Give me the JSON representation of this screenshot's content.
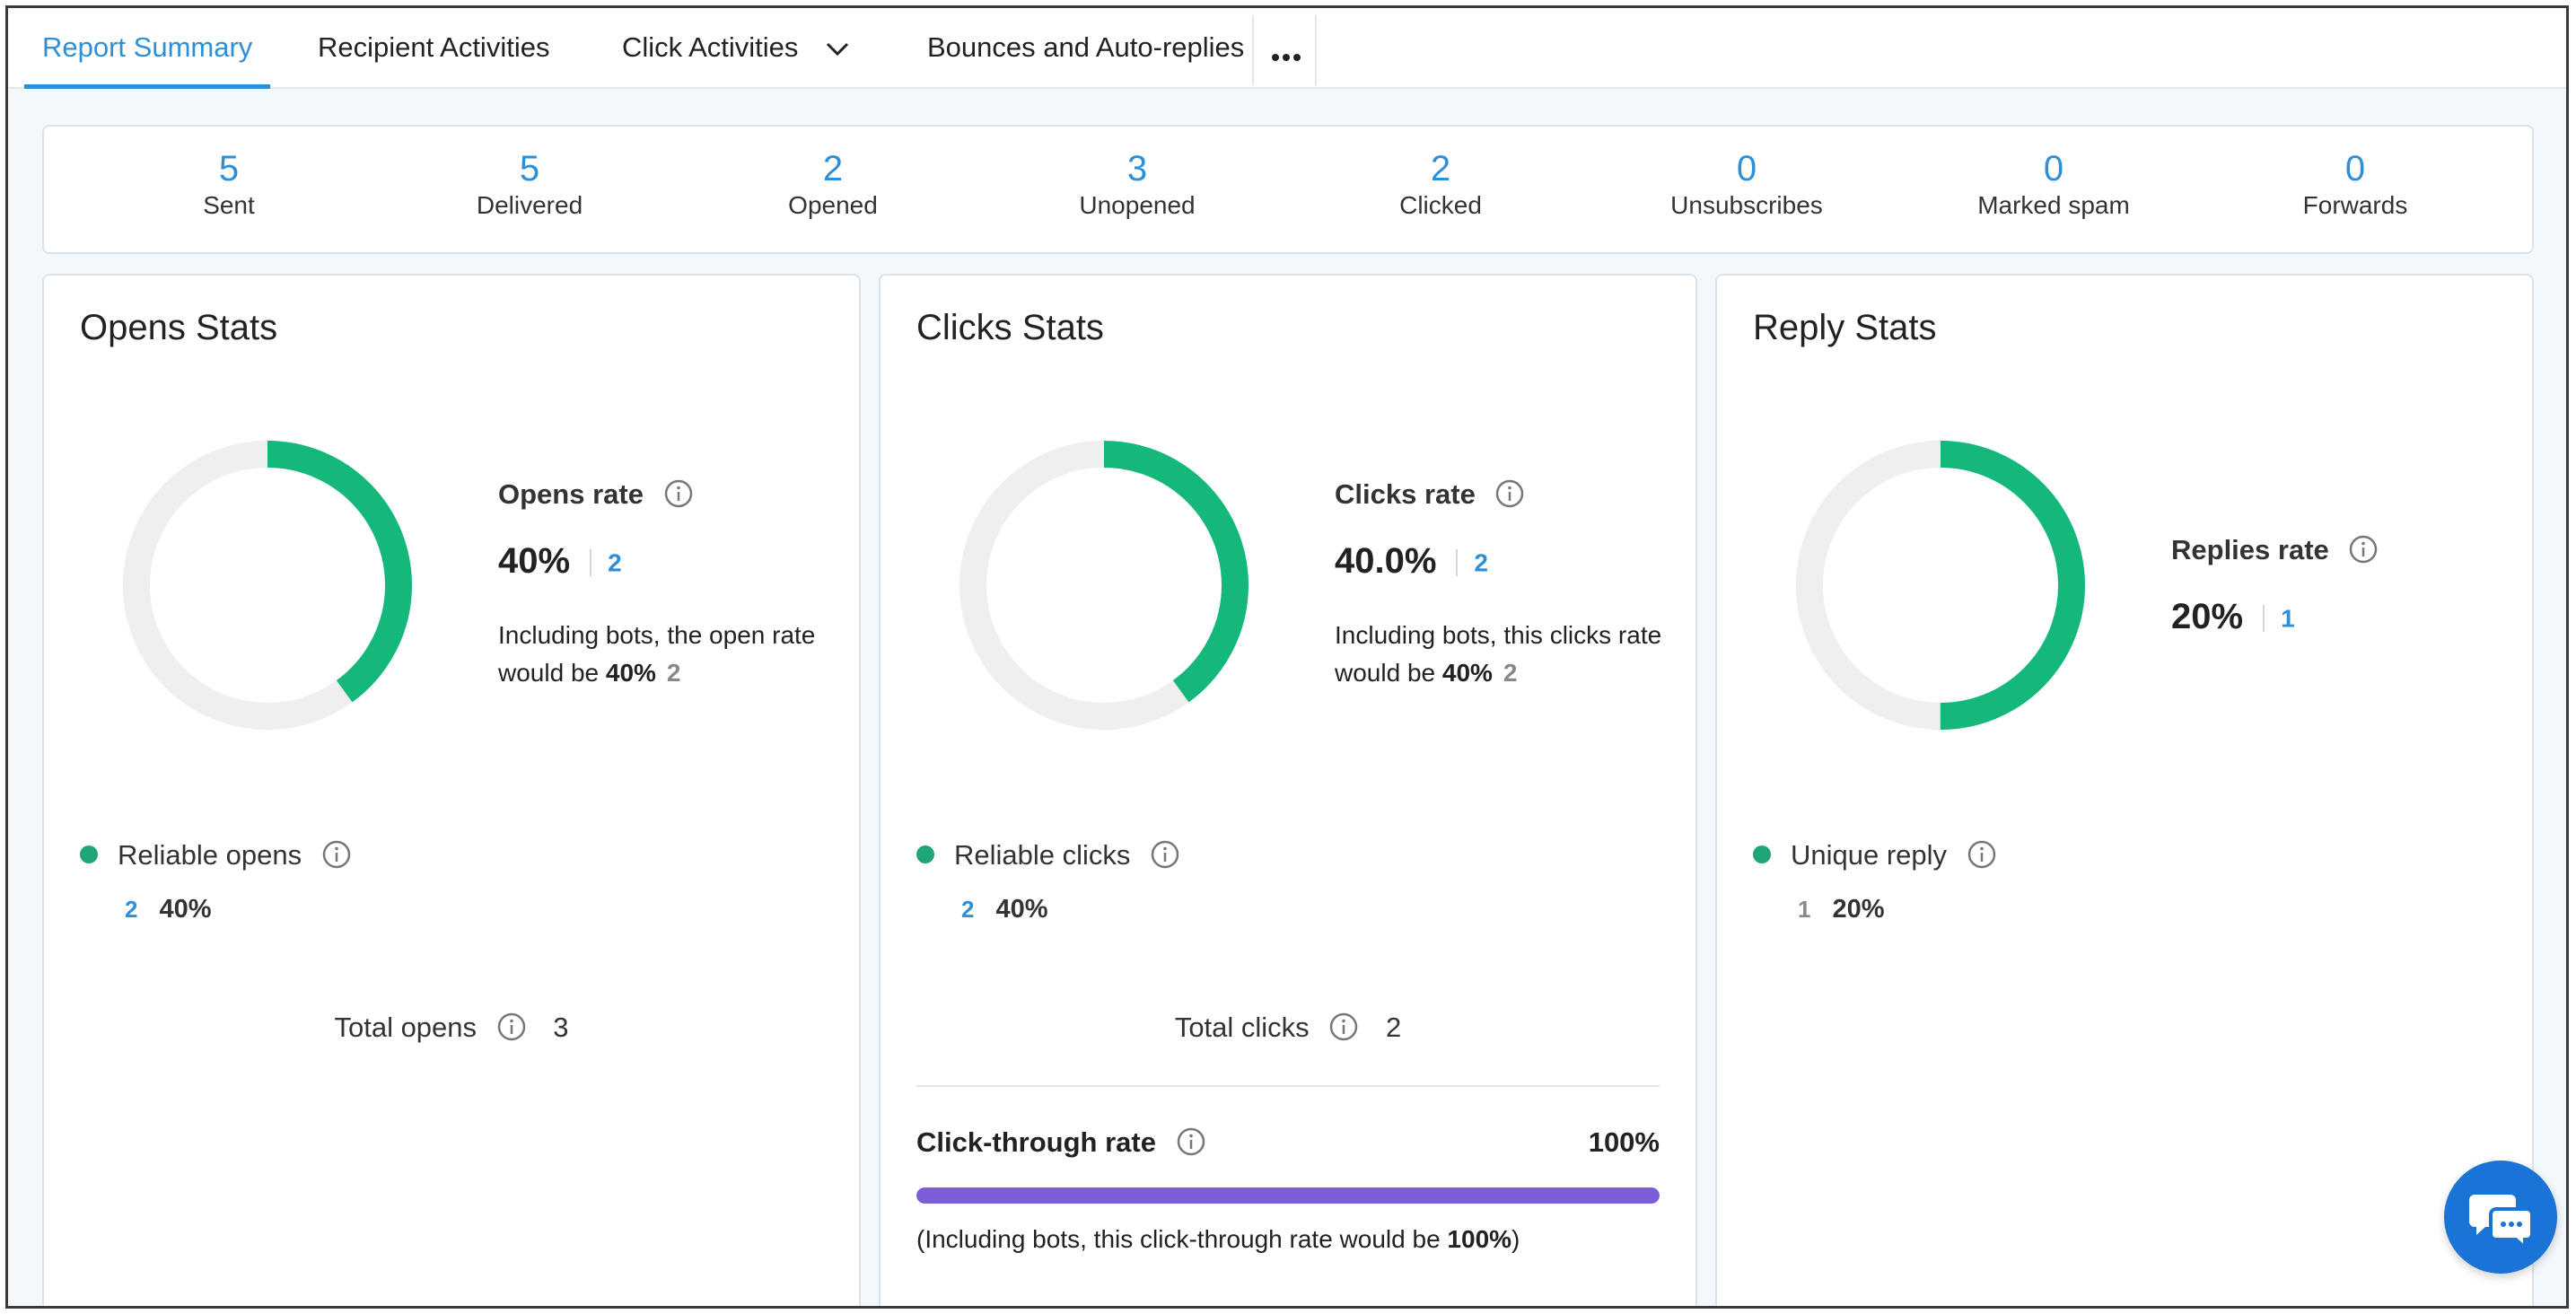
{
  "tabs": {
    "report_summary": "Report Summary",
    "recipient_activities": "Recipient Activities",
    "click_activities": "Click Activities",
    "bounces": "Bounces and Auto-replies",
    "more_icon": "ellipsis-icon"
  },
  "summary": [
    {
      "value": "5",
      "label": "Sent"
    },
    {
      "value": "5",
      "label": "Delivered"
    },
    {
      "value": "2",
      "label": "Opened"
    },
    {
      "value": "3",
      "label": "Unopened"
    },
    {
      "value": "2",
      "label": "Clicked"
    },
    {
      "value": "0",
      "label": "Unsubscribes"
    },
    {
      "value": "0",
      "label": "Marked spam"
    },
    {
      "value": "0",
      "label": "Forwards"
    }
  ],
  "opens": {
    "title": "Opens Stats",
    "rate_title": "Opens rate",
    "rate_value": "40%",
    "rate_count": "2",
    "rate_fraction": 0.4,
    "bots_text": "Including bots, the open rate would be",
    "bots_rate": "40%",
    "bots_count": "2",
    "legend_label": "Reliable opens",
    "legend_count": "2",
    "legend_percent": "40%",
    "total_label": "Total opens",
    "total_value": "3"
  },
  "clicks": {
    "title": "Clicks Stats",
    "rate_title": "Clicks rate",
    "rate_value": "40.0%",
    "rate_count": "2",
    "rate_fraction": 0.4,
    "bots_text": "Including bots, this clicks rate would be",
    "bots_rate": "40%",
    "bots_count": "2",
    "legend_label": "Reliable clicks",
    "legend_count": "2",
    "legend_percent": "40%",
    "total_label": "Total clicks",
    "total_value": "2",
    "ctr_title": "Click-through rate",
    "ctr_value": "100%",
    "ctr_fraction": 1.0,
    "ctr_note_prefix": "(Including bots, this click-through rate would be",
    "ctr_note_value": "100%",
    "ctr_note_suffix": ")"
  },
  "replies": {
    "title": "Reply Stats",
    "rate_title": "Replies rate",
    "rate_value": "20%",
    "rate_count": "1",
    "rate_fraction": 0.5,
    "legend_label": "Unique reply",
    "legend_count": "1",
    "legend_percent": "20%"
  },
  "colors": {
    "accent": "#2d8fd5",
    "donut_fill": "#14b87b",
    "donut_track": "#efefef",
    "ctr_bar": "#7b5fd8",
    "chat_button": "#1a73d6"
  },
  "chat_icon": "chat-bubbles-icon"
}
